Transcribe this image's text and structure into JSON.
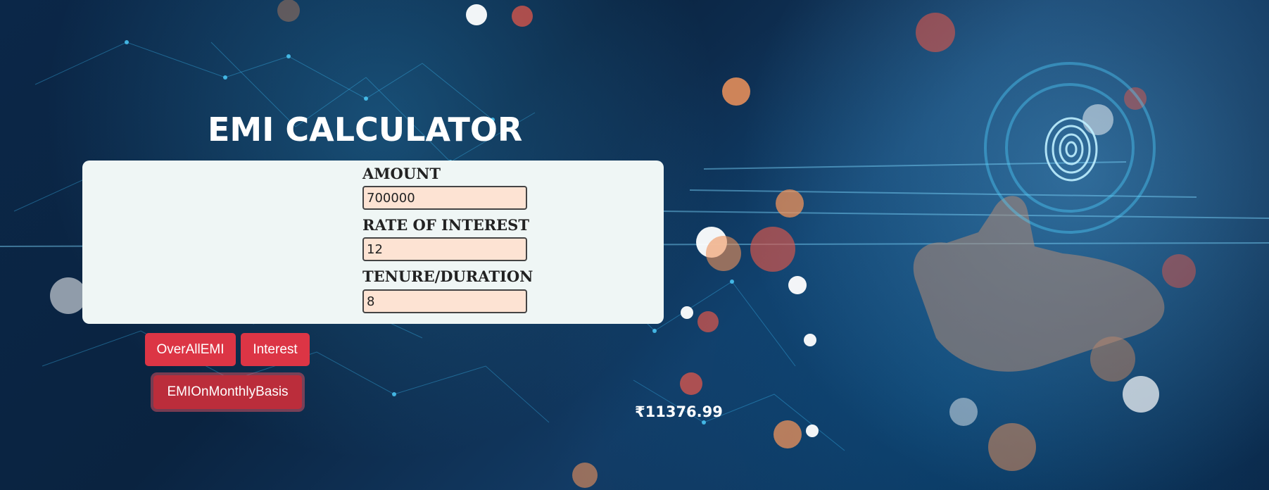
{
  "app": {
    "title": "EMI CALCULATOR"
  },
  "form": {
    "amount": {
      "label": "AMOUNT",
      "value": "700000"
    },
    "rate": {
      "label": "RATE OF INTEREST",
      "value": "12"
    },
    "tenure": {
      "label": "TENURE/DURATION",
      "value": "8"
    }
  },
  "buttons": {
    "overall_emi": "OverAllEMI",
    "interest": "Interest",
    "emi_monthly": "EMIOnMonthlyBasis"
  },
  "result": {
    "text": "₹11376.99"
  },
  "colors": {
    "panel": "#eff6f5",
    "input_bg": "#fde3d3",
    "button": "#dc3545",
    "button_focused": "#bb2d3b"
  },
  "icons": {
    "background": "tech-network-fingerprint-background"
  }
}
